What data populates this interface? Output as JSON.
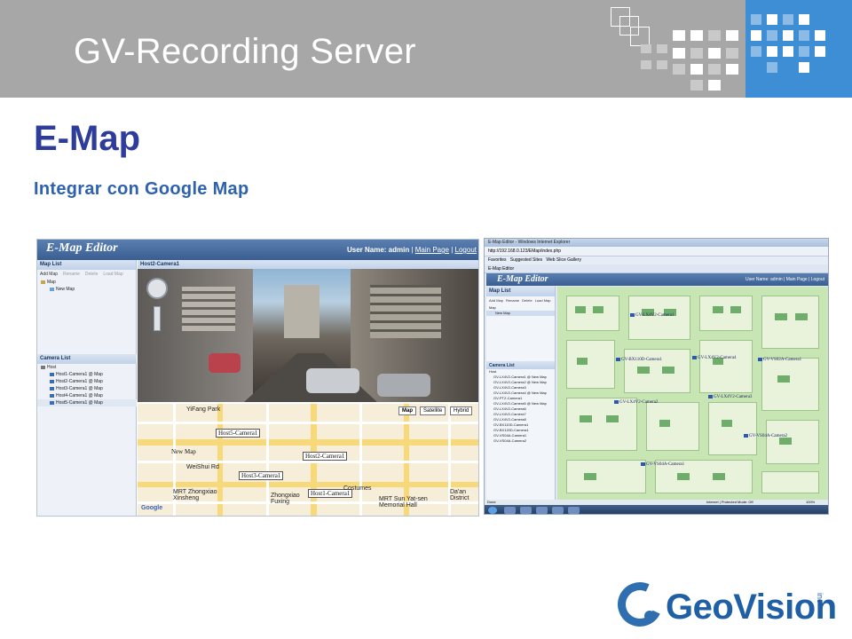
{
  "slide": {
    "header_title": "GV-Recording Server",
    "title": "E-Map",
    "subtitle": "Integrar con Google Map",
    "logo_text": "GeoVision",
    "logo_suffix": "inc",
    "colors": {
      "header_gray": "#a7a7a7",
      "accent_blue": "#3d8ed4",
      "title_blue": "#2e3c9a",
      "subtitle_blue": "#2e62b0"
    }
  },
  "shot1": {
    "brand": "E-Map Editor",
    "user_label": "User Name: admin",
    "main_page": "Main Page",
    "logout": "Logout",
    "map_list_header": "Map List",
    "tools": [
      "Add Map",
      "Rename",
      "Delete",
      "Load Map"
    ],
    "tree_root": "Map",
    "tree_child": "New Map",
    "camera_list_header": "Camera List",
    "host": "Host",
    "cameras": [
      "Host1-Camera1 @ Map",
      "Host2-Camera1 @ Map",
      "Host3-Camera1 @ Map",
      "Host4-Camera1 @ Map",
      "Host5-Camera1 @ Map"
    ],
    "view_tab": "Host2-Camera1",
    "map_types": [
      "Map",
      "Satellite",
      "Hybrid"
    ],
    "map_labels": {
      "cam5": "Host5-Camera1",
      "cam2": "Host2-Camera1",
      "cam3": "Host3-Camera1",
      "cam1": "Host1-Camera1",
      "newmap": "New Map",
      "street1": "MRT Zhongxiao Xinsheng",
      "street2": "Zhongxiao Fuxing",
      "street3": "MRT Sun Yat-sen Memorial Hall",
      "district": "Da'an District",
      "road": "WeiShui Rd",
      "park": "YiFang Park",
      "google": "Google",
      "costumes": "Costumes"
    }
  },
  "shot2": {
    "window_title": "E-Map Editor - Windows Internet Explorer",
    "address": "http://192.168.0.123/EMap/index.php",
    "favorites": [
      "Favorites",
      "Suggested Sites",
      "Web Slice Gallery"
    ],
    "tab_label": "E-Map Editor",
    "brand": "E-Map Editor",
    "user_label": "User Name: admin | Main Page | Logout",
    "map_list_header": "Map List",
    "tools": [
      "Add Map",
      "Rename",
      "Delete",
      "Load Map"
    ],
    "tree_root": "Map",
    "tree_child": "New Map",
    "camera_list_header": "Camera List",
    "host": "Host",
    "cameras": [
      "GV-LX4V2-Camera1 @ New Map",
      "GV-LX4V2-Camera2 @ New Map",
      "GV-LX4V2-Camera3",
      "GV-LX4V2-Camera4 @ New Map",
      "GV-PTZ-Camera1",
      "GV-LX4V2-Camera5 @ New Map",
      "GV-LX4V2-Camera6",
      "GV-LX4V2-Camera7",
      "GV-LX4V2-Camera8",
      "GV-BX110D-Camera1",
      "GV-BX120D-Camera1",
      "GV-VS04A-Camera1",
      "GV-VS04A-Camera2"
    ],
    "floor_cams": [
      "GV-LX4V2-Camera1",
      "GV-BX110D-Camera1",
      "GV-LX4V2-Camera4",
      "GV-VS02A-Camera1",
      "GV-LX4V2-Camera2",
      "GV-LX4V2-Camera3",
      "GV-VS04A-Camera1",
      "GV-VS04A-Camera2"
    ],
    "status_left": "Done",
    "status_right": "Internet | Protected Mode: Off",
    "zoom": "100%"
  }
}
